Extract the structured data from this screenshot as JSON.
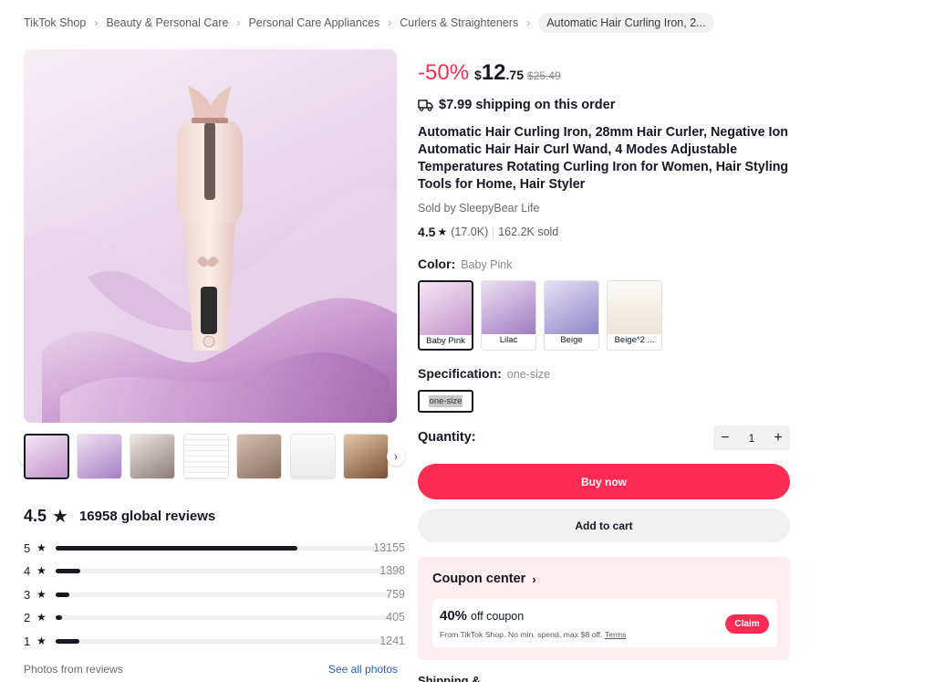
{
  "breadcrumb": {
    "items": [
      "TikTok Shop",
      "Beauty & Personal Care",
      "Personal Care Appliances",
      "Curlers & Straighteners"
    ],
    "current": "Automatic Hair Curling Iron, 2..."
  },
  "gallery": {
    "thumbnail_count": 7,
    "next_arrow": "›",
    "prev_arrow": "‹"
  },
  "reviews": {
    "score": "4.5",
    "star": "★",
    "total_label": "16958 global reviews",
    "breakdown": [
      {
        "stars": "5",
        "count": "13155",
        "fraction": 0.725
      },
      {
        "stars": "4",
        "count": "1398",
        "fraction": 0.075
      },
      {
        "stars": "3",
        "count": "759",
        "fraction": 0.04
      },
      {
        "stars": "2",
        "count": "405",
        "fraction": 0.02
      },
      {
        "stars": "1",
        "count": "1241",
        "fraction": 0.07
      }
    ],
    "photos_label": "Photos from reviews",
    "see_all": "See all photos"
  },
  "product": {
    "discount": "-50%",
    "currency": "$",
    "price_int": "12",
    "price_dec": ".75",
    "original_price": "$25.49",
    "shipping": "$7.99 shipping on this order",
    "title": "Automatic Hair Curling Iron, 28mm Hair Curler, Negative Ion Automatic Hair Hair Curl Wand, 4 Modes Adjustable Temperatures Rotating Curling Iron for Women, Hair Styling Tools for Home, Hair Styler",
    "seller": "Sold by SleepyBear Life",
    "rating": "4.5",
    "rating_star": "★",
    "rating_count": "(17.0K)",
    "sold": "162.2K sold"
  },
  "color": {
    "label": "Color:",
    "selected": "Baby Pink",
    "options": [
      "Baby Pink",
      "Lilac",
      "Beige",
      "Beige*2 ..."
    ]
  },
  "specification": {
    "label": "Specification:",
    "selected": "one-size",
    "options": [
      "one-size"
    ]
  },
  "quantity": {
    "label": "Quantity:",
    "value": "1",
    "minus": "−",
    "plus": "+"
  },
  "actions": {
    "buy_now": "Buy now",
    "add_to_cart": "Add to cart"
  },
  "coupon": {
    "title": "Coupon center",
    "chevron": "›",
    "percent": "40%",
    "label": "off coupon",
    "details": "From TikTok Shop. No min. spend. max $8 off.",
    "terms": "Terms",
    "claim": "Claim"
  },
  "next_section_partial": "Shipping &"
}
